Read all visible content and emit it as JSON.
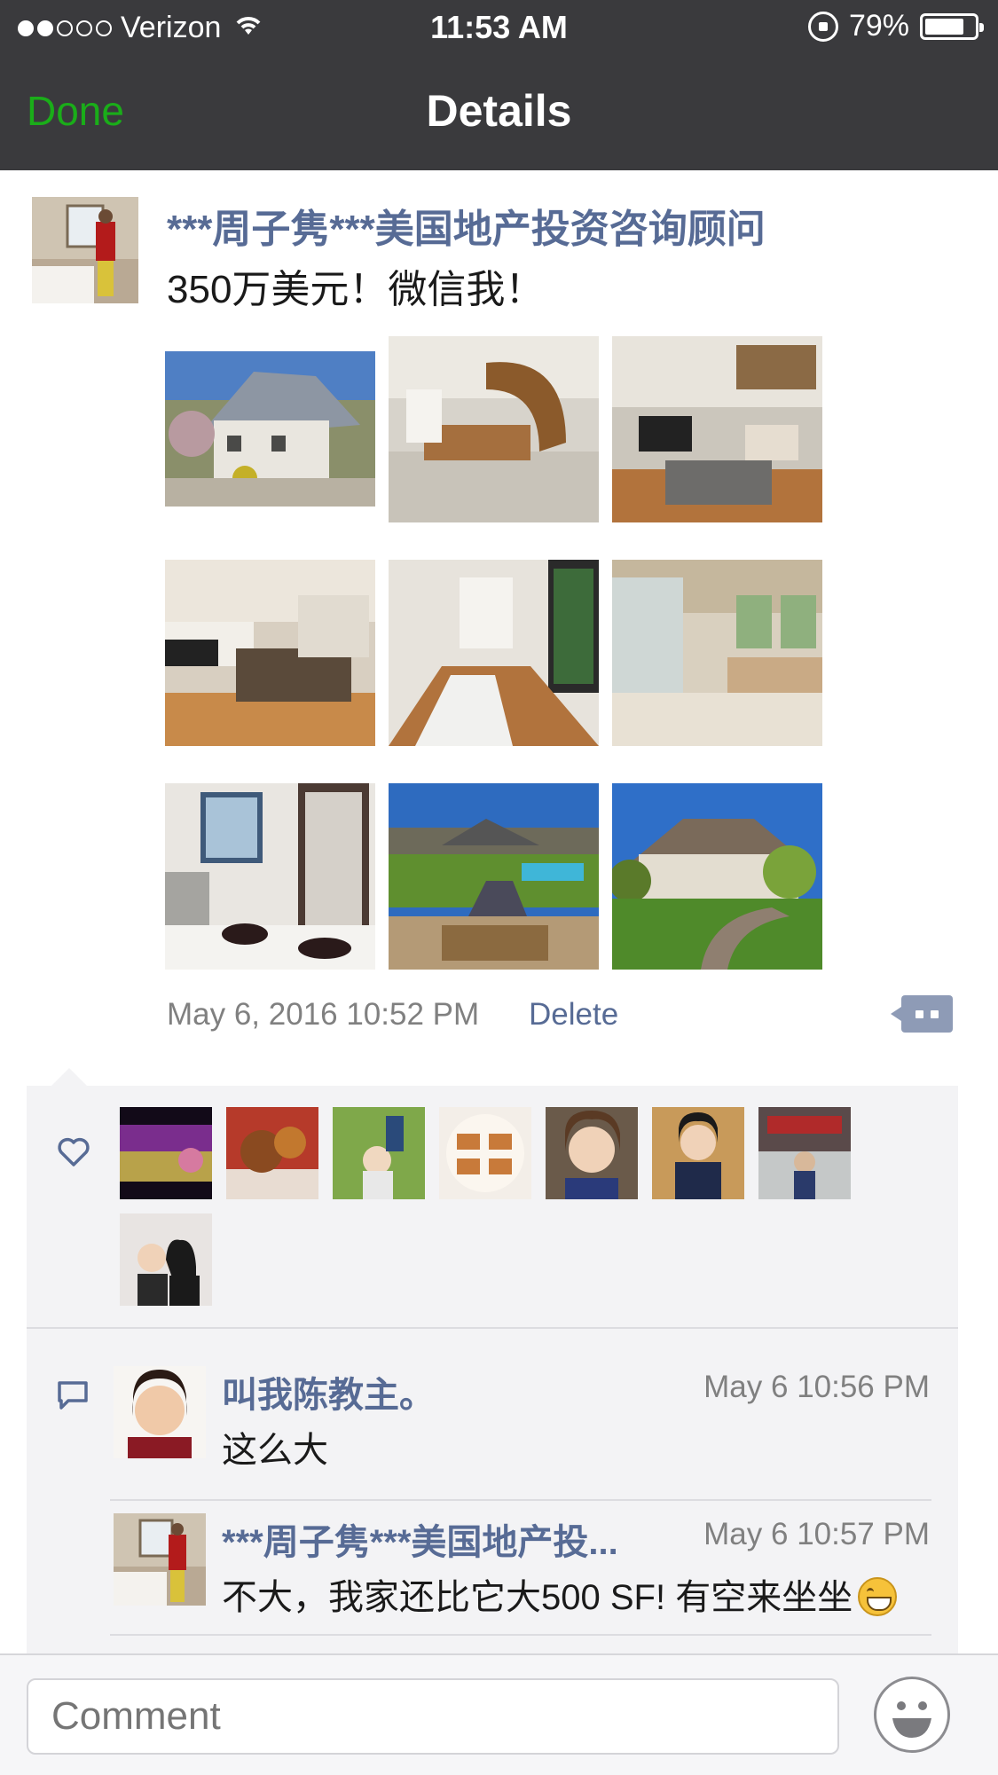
{
  "status_bar": {
    "carrier": "Verizon",
    "time": "11:53 AM",
    "battery": "79%",
    "battery_level": 0.79,
    "signal_icon": "signal-dots-icon",
    "wifi_icon": "wifi-icon"
  },
  "nav": {
    "done_label": "Done",
    "title": "Details"
  },
  "post": {
    "author": "***周子隽***美国地产投资咨询顾问",
    "text": "350万美元！微信我！",
    "timestamp": "May 6, 2016 10:52 PM",
    "delete_label": "Delete",
    "photos": [
      "house-exterior-photo",
      "foyer-staircase-photo",
      "living-room-piano-photo",
      "kitchen-photo",
      "hallway-photo",
      "bathroom-shower-photo",
      "bathroom-tile-photo",
      "garden-pool-photo",
      "backyard-house-photo"
    ]
  },
  "likes": {
    "icon": "heart-icon",
    "avatars": [
      "liker-avatar-flowers",
      "liker-avatar-food",
      "liker-avatar-kids-park",
      "liker-avatar-dish",
      "liker-avatar-woman-selfie",
      "liker-avatar-woman-cafe",
      "liker-avatar-elephant",
      "liker-avatar-couple"
    ]
  },
  "comments": {
    "icon": "comment-bubble-icon",
    "items": [
      {
        "name": "叫我陈教主。",
        "time": "May 6 10:56 PM",
        "text": "这么大"
      },
      {
        "name": "***周子隽***美国地产投...",
        "time": "May 6 10:57 PM",
        "text": "不大，我家还比它大500 SF! 有空来坐坐",
        "emoji": "grin-emoji-icon"
      }
    ]
  },
  "composer": {
    "placeholder": "Comment",
    "emoji_icon": "smiley-icon"
  },
  "colors": {
    "nav_bg": "#3a3a3d",
    "done_green": "#1aad19",
    "link_blue": "#576b95",
    "panel_bg": "#f3f3f5"
  }
}
